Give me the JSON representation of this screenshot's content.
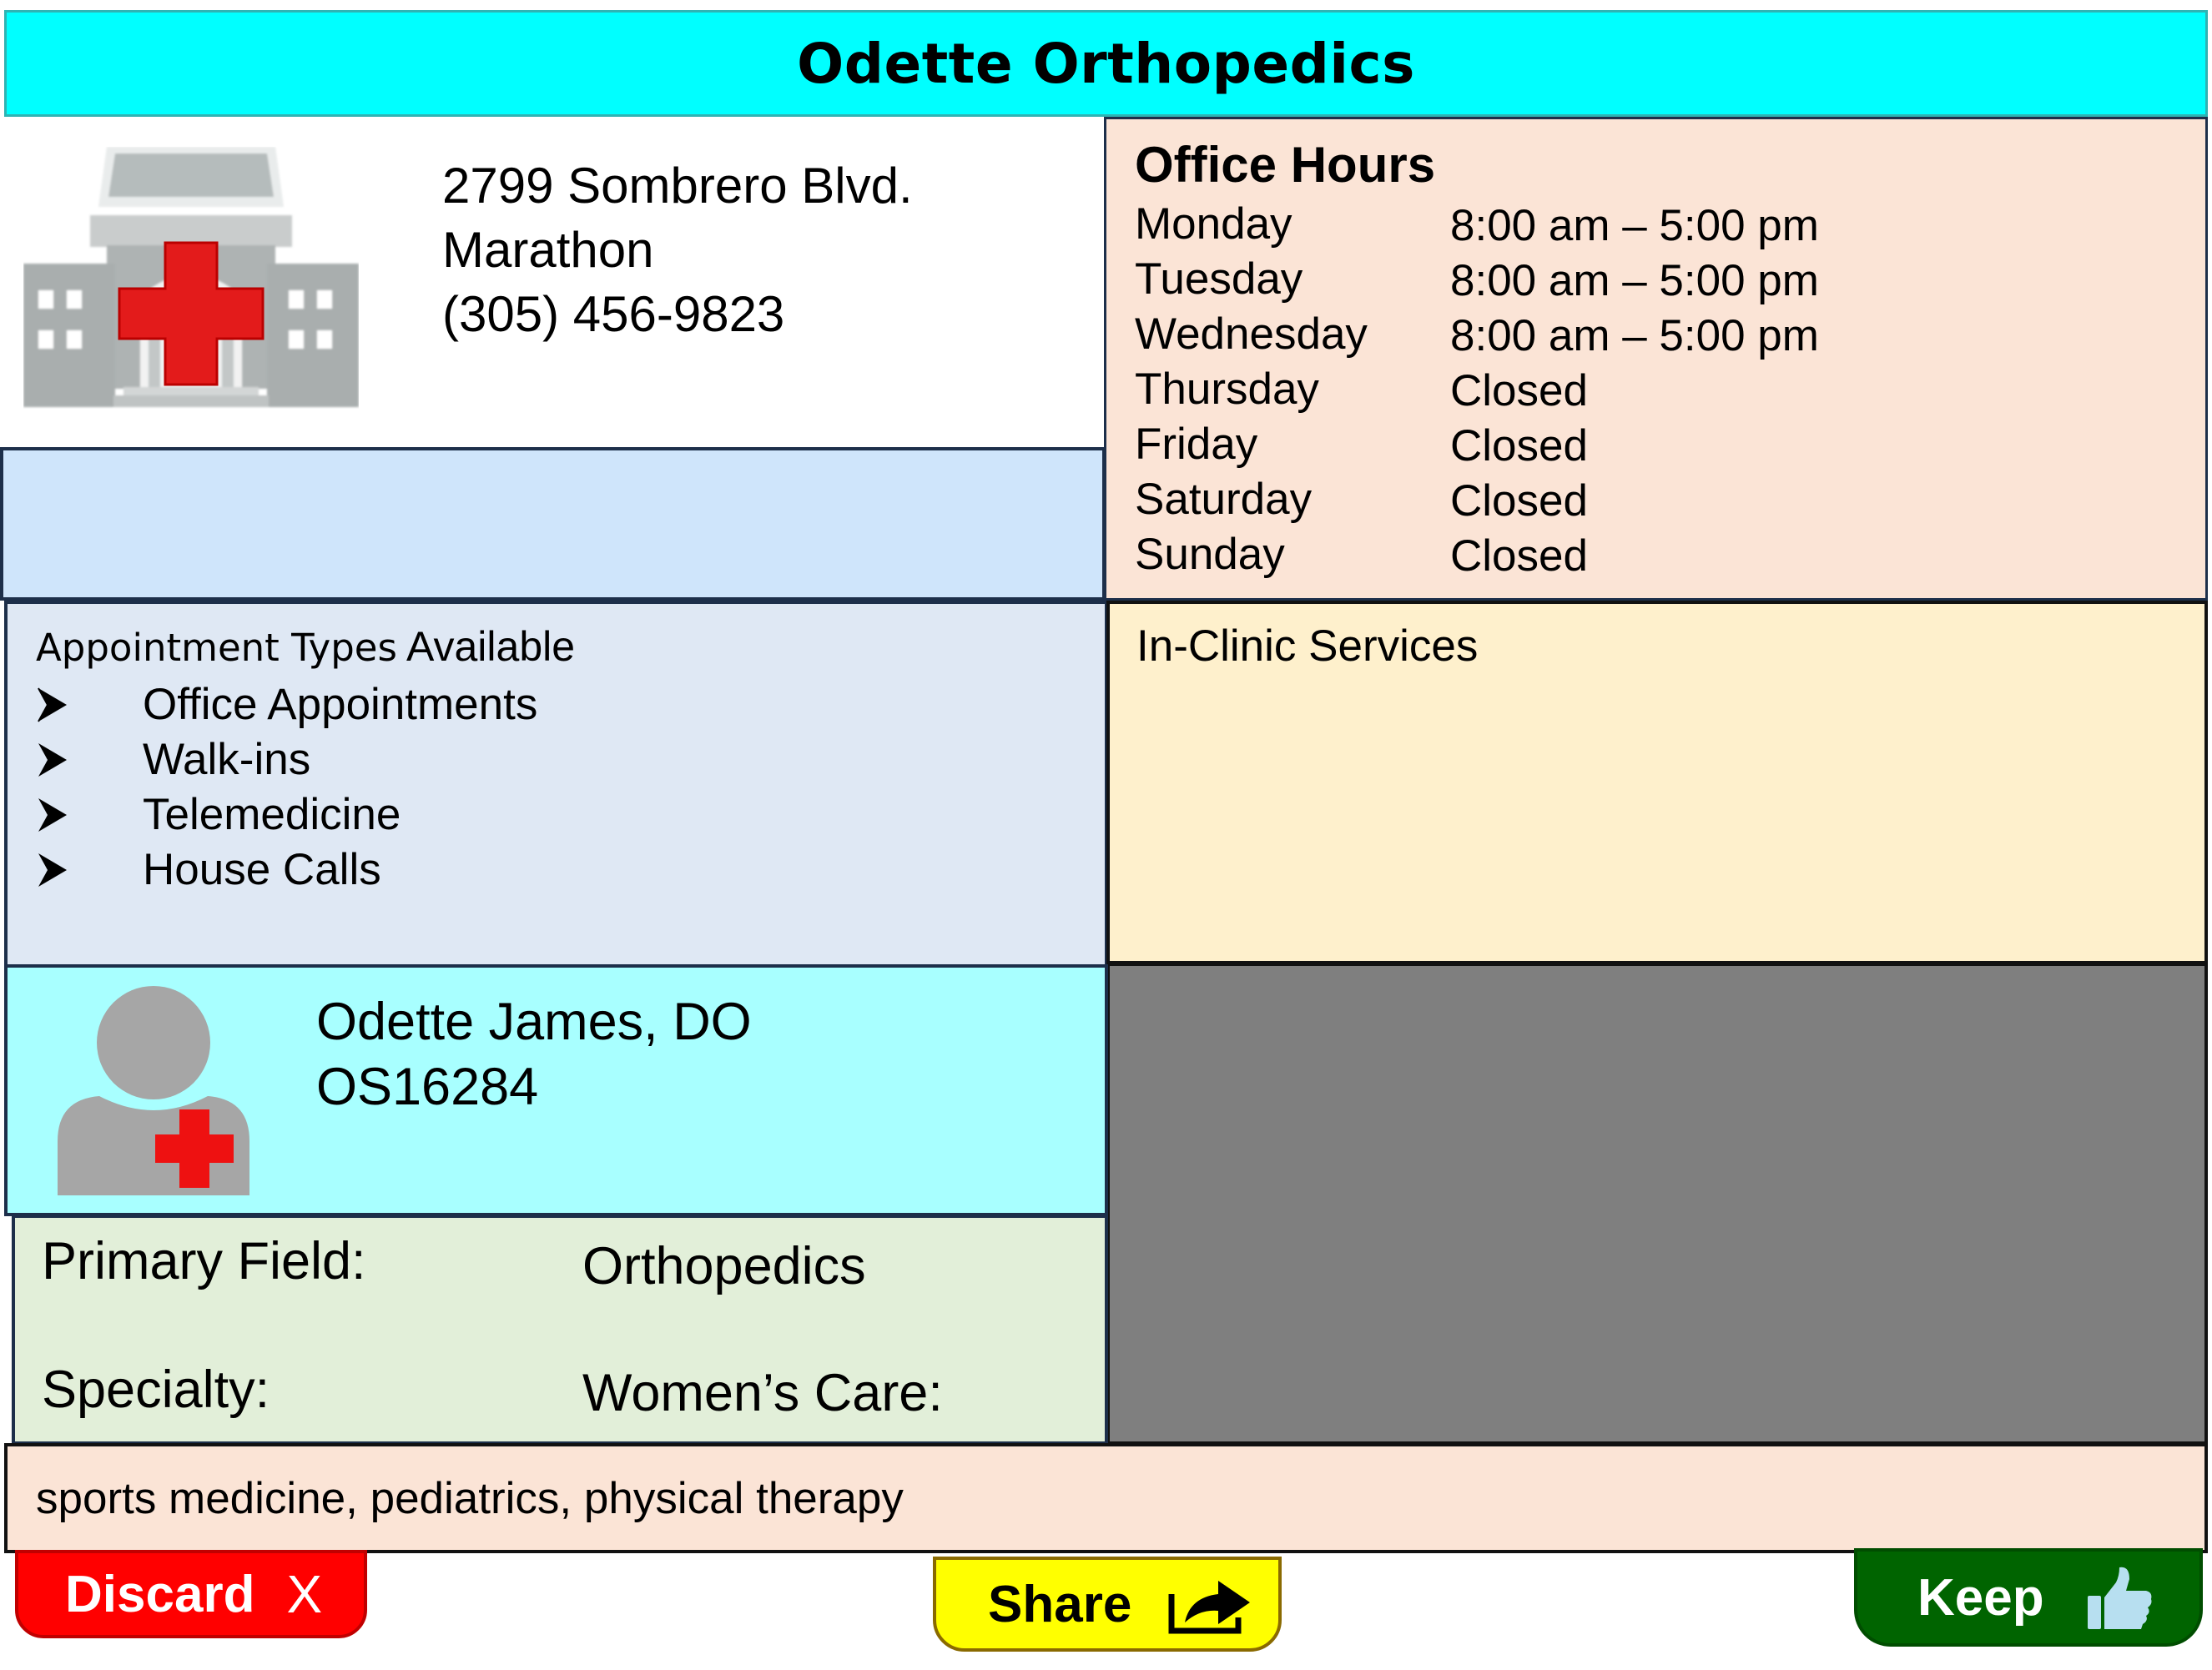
{
  "header": {
    "title": "Odette Orthopedics"
  },
  "clinic": {
    "address_line1": "2799 Sombrero Blvd.",
    "city": "Marathon",
    "phone": "(305) 456-9823",
    "icon": "hospital-icon"
  },
  "office_hours": {
    "title": "Office Hours",
    "days": [
      {
        "day": "Monday",
        "hours": "8:00 am – 5:00 pm"
      },
      {
        "day": "Tuesday",
        "hours": "8:00 am – 5:00 pm"
      },
      {
        "day": "Wednesday",
        "hours": "8:00 am – 5:00 pm"
      },
      {
        "day": "Thursday",
        "hours": "Closed"
      },
      {
        "day": "Friday",
        "hours": "Closed"
      },
      {
        "day": "Saturday",
        "hours": "Closed"
      },
      {
        "day": "Sunday",
        "hours": "Closed"
      }
    ]
  },
  "appointments": {
    "heading_small": "Appointment Types",
    "heading_rest": "Available",
    "items": [
      "Office Appointments",
      "Walk-ins",
      "Telemedicine",
      "House Calls"
    ]
  },
  "in_clinic": {
    "title": "In-Clinic Services"
  },
  "doctor": {
    "name": "Odette James, DO",
    "id": "OS16284",
    "icon": "doctor-avatar-icon"
  },
  "fields": {
    "primary_label": "Primary Field:",
    "primary_value": "Orthopedics",
    "specialty_label": "Specialty:",
    "specialty_value": "Women’s Care:"
  },
  "services": {
    "text": "sports medicine, pediatrics, physical therapy"
  },
  "actions": {
    "discard_label": "Discard",
    "discard_icon_glyph": "X",
    "share_label": "Share",
    "keep_label": "Keep"
  },
  "colors": {
    "title_bar": "#00ffff",
    "office_hours_bg": "#fbe4d6",
    "appointments_bg": "#dfe8f4",
    "in_clinic_bg": "#fef0cc",
    "doctor_bg": "#a8ffff",
    "fields_bg": "#e2efd9",
    "discard": "#ff0000",
    "share": "#ffff00",
    "keep": "#006400"
  }
}
